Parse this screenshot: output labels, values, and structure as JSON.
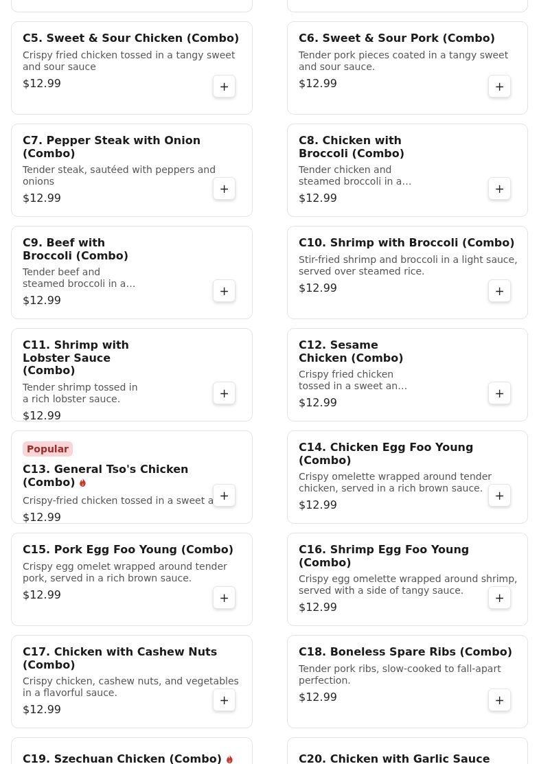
{
  "items": [
    {
      "kind": "wide",
      "title": "C5. Sweet & Sour Chicken (Combo)",
      "description": "Crispy fried chicken tossed in a tangy sweet and sour sauce",
      "price": "$12.99",
      "button": "+"
    },
    {
      "kind": "wide",
      "title": "C6. Sweet & Sour Pork (Combo)",
      "description": "Tender pork pieces coated in a tangy sweet and sour sauce.",
      "price": "$12.99",
      "button": "+"
    },
    {
      "kind": "wide",
      "title": "C7. Pepper Steak with Onion (Combo)",
      "description": "Tender steak, sautéed with peppers and onions",
      "price": "$12.99",
      "button": "+"
    },
    {
      "kind": "narrow",
      "title": "C8. Chicken with Broccoli (Combo)",
      "description": "Tender chicken and steamed broccoli in a…",
      "price": "$12.99",
      "button": "+"
    },
    {
      "kind": "narrow",
      "title": "C9. Beef with Broccoli (Combo)",
      "description": "Tender beef and steamed broccoli in a…",
      "price": "$12.99",
      "button": "+"
    },
    {
      "kind": "wide",
      "title": "C10. Shrimp with Broccoli (Combo)",
      "description": "Stir-fried shrimp and broccoli in a light sauce, served over steamed rice.",
      "price": "$12.99",
      "button": "+"
    },
    {
      "kind": "narrow",
      "title": "C11. Shrimp with Lobster Sauce (Combo)",
      "description": "Tender shrimp tossed in a rich lobster sauce.",
      "price": "$12.99",
      "button": "+"
    },
    {
      "kind": "narrow",
      "title": "C12. Sesame Chicken (Combo)",
      "description": "Crispy fried chicken tossed in a sweet an…",
      "price": "$12.99",
      "button": "+"
    },
    {
      "kind": "wide",
      "badge": "Popular",
      "title": "C13. General Tso's Chicken (Combo)",
      "spicy": true,
      "description": "Crispy-fried chicken tossed in a sweet a",
      "price": "$12.99",
      "button": "+"
    },
    {
      "kind": "wide",
      "title": "C14. Chicken Egg Foo Young (Combo)",
      "description": "Crispy omelette wrapped around tender chicken, served in a rich brown sauce.",
      "price": "$12.99",
      "button": "+"
    },
    {
      "kind": "wide",
      "title": "C15. Pork Egg Foo Young (Combo)",
      "description": "Crispy egg omelet wrapped around tender pork, served in a rich brown sauce.",
      "price": "$12.99",
      "button": "+"
    },
    {
      "kind": "wide",
      "title": "C16. Shrimp Egg Foo Young (Combo)",
      "description": "Crispy egg omelette wrapped around shrimp, served with a side of tangy sauce.",
      "price": "$12.99",
      "button": "+"
    },
    {
      "kind": "wide",
      "title": "C17. Chicken with Cashew Nuts (Combo)",
      "description": "Crispy chicken, cashew nuts, and vegetables in a flavorful sauce.",
      "price": "$12.99",
      "button": "+"
    },
    {
      "kind": "wide",
      "title": "C18. Boneless Spare Ribs (Combo)",
      "description": "Tender pork ribs, slow-cooked to fall-apart perfection.",
      "price": "$12.99",
      "button": "+"
    },
    {
      "kind": "cut",
      "title": "C19. Szechuan Chicken (Combo)",
      "spicy": true
    },
    {
      "kind": "cut",
      "title": "C20. Chicken with Garlic Sauce"
    }
  ]
}
